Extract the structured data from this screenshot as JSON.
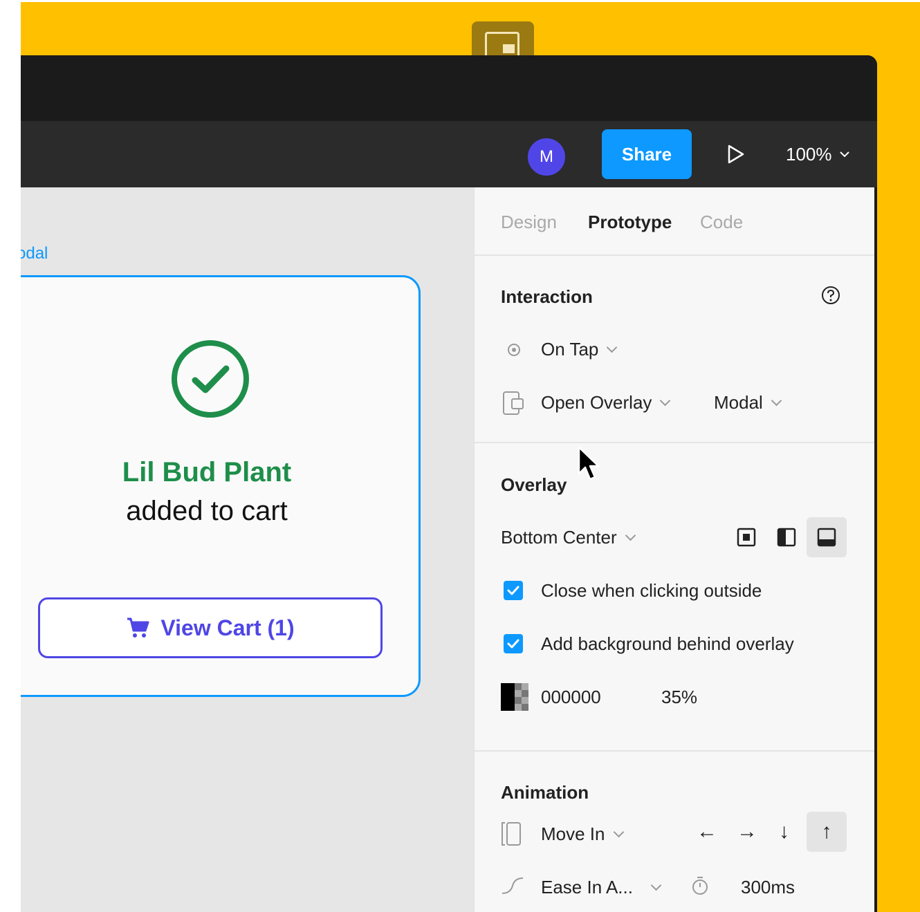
{
  "toolbar": {
    "avatar_initial": "M",
    "share_label": "Share",
    "zoom_label": "100%"
  },
  "canvas": {
    "frame_label": "odal",
    "modal": {
      "product_name": "Lil Bud Plant",
      "added_text": "added to cart",
      "view_cart_label": "View Cart (1)"
    }
  },
  "panel": {
    "tabs": [
      {
        "label": "Design",
        "active": false
      },
      {
        "label": "Prototype",
        "active": true
      },
      {
        "label": "Code",
        "active": false
      }
    ],
    "interaction": {
      "title": "Interaction",
      "trigger": "On Tap",
      "action": "Open Overlay",
      "destination": "Modal"
    },
    "overlay": {
      "title": "Overlay",
      "position": "Bottom Center",
      "close_outside_label": "Close when clicking outside",
      "close_outside_checked": true,
      "background_label": "Add background behind overlay",
      "background_checked": true,
      "background_color": "000000",
      "background_opacity": "35%"
    },
    "animation": {
      "title": "Animation",
      "type": "Move In",
      "easing": "Ease In A...",
      "duration": "300ms",
      "selected_direction": "up"
    }
  },
  "colors": {
    "figma_blue": "#0D99FF",
    "success_green": "#1E8E4A",
    "indigo": "#4F46E5",
    "backdrop_yellow": "#FFC000",
    "avatar_purple": "#5046E8"
  }
}
